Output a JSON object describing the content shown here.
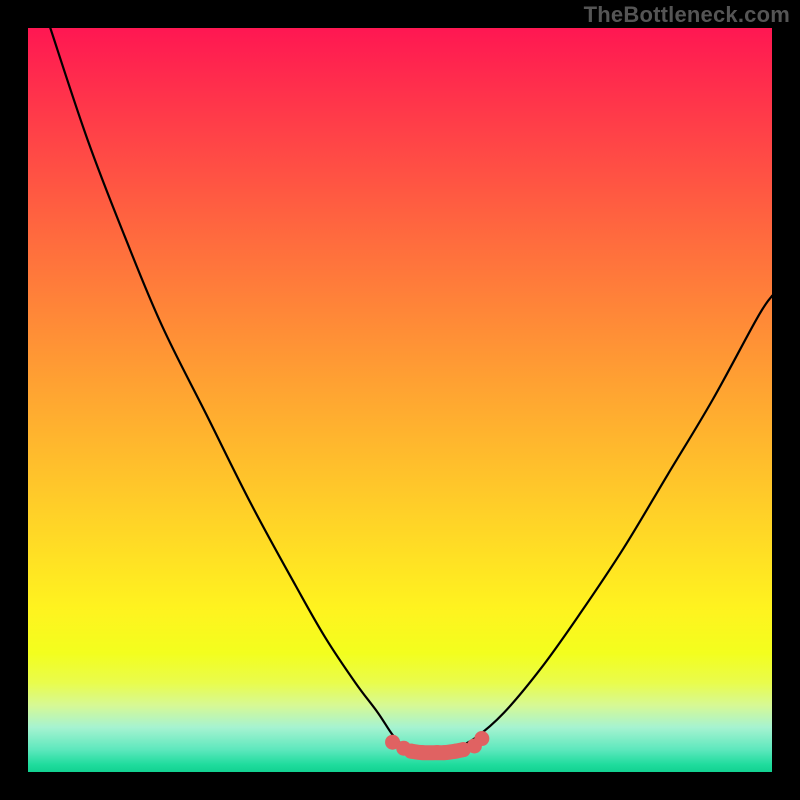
{
  "watermark": {
    "text": "TheBottleneck.com"
  },
  "colors": {
    "background": "#000000",
    "curve": "#000000",
    "marker": "#e06262",
    "watermark": "#555555"
  },
  "chart_data": {
    "type": "line",
    "title": "",
    "xlabel": "",
    "ylabel": "",
    "xlim": [
      0,
      100
    ],
    "ylim": [
      0,
      100
    ],
    "grid": false,
    "legend": false,
    "series": [
      {
        "name": "left-curve",
        "x": [
          3,
          8,
          13,
          18,
          24,
          30,
          36,
          40,
          44,
          47,
          49,
          50.5,
          51.5
        ],
        "y": [
          100,
          85,
          72,
          60,
          48,
          36,
          25,
          18,
          12,
          8,
          5,
          3.5,
          3
        ]
      },
      {
        "name": "right-curve",
        "x": [
          57,
          60,
          64,
          69,
          74,
          80,
          86,
          92,
          98,
          100
        ],
        "y": [
          3,
          4.5,
          8,
          14,
          21,
          30,
          40,
          50,
          61,
          64
        ]
      },
      {
        "name": "valley-markers",
        "x": [
          49,
          50.5,
          51.5,
          53,
          55,
          56,
          57.5,
          58.5,
          60,
          61
        ],
        "y": [
          4,
          3.2,
          2.8,
          2.6,
          2.6,
          2.6,
          2.8,
          3,
          3.5,
          4.5
        ]
      }
    ]
  }
}
